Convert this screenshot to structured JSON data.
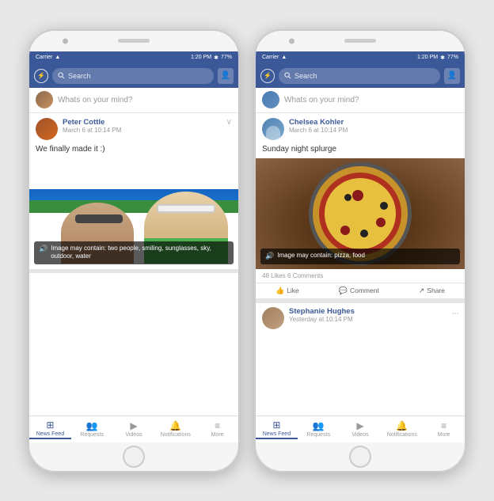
{
  "page": {
    "background": "#e8e8e8"
  },
  "phone1": {
    "status_bar": {
      "carrier": "Carrier",
      "wifi": "wifi",
      "time": "1:20 PM",
      "bluetooth": "BT",
      "battery": "77%"
    },
    "nav": {
      "search_placeholder": "Search"
    },
    "whats_on_mind": "Whats on your mind?",
    "post": {
      "author": "Peter Cottle",
      "date": "March 6 at 10:14 PM",
      "text": "We finally made it :)",
      "image_caption": "Image may contain: two people, smiling, sunglasses, sky, outdoor, water"
    },
    "bottom_nav": {
      "items": [
        {
          "label": "News Feed",
          "active": true
        },
        {
          "label": "Requests",
          "active": false
        },
        {
          "label": "Videos",
          "active": false
        },
        {
          "label": "Notifications",
          "active": false
        },
        {
          "label": "More",
          "active": false
        }
      ]
    }
  },
  "phone2": {
    "status_bar": {
      "carrier": "Carrier",
      "wifi": "wifi",
      "time": "1:20 PM",
      "bluetooth": "BT",
      "battery": "77%"
    },
    "nav": {
      "search_placeholder": "Search"
    },
    "whats_on_mind": "Whats on your mind?",
    "post": {
      "author": "Chelsea Kohler",
      "date": "March 6 at 10:14 PM",
      "text": "Sunday night splurge",
      "image_caption": "Image may contain: pizza, food",
      "stats": "48 Likes  6 Comments"
    },
    "actions": {
      "like": "Like",
      "comment": "Comment",
      "share": "Share"
    },
    "next_post": {
      "author": "Stephanie Hughes",
      "date": "Yesterday at 10:14 PM"
    },
    "bottom_nav": {
      "items": [
        {
          "label": "News Feed",
          "active": true
        },
        {
          "label": "Requests",
          "active": false
        },
        {
          "label": "Videos",
          "active": false
        },
        {
          "label": "Notifications",
          "active": false
        },
        {
          "label": "More",
          "active": false
        }
      ]
    }
  }
}
